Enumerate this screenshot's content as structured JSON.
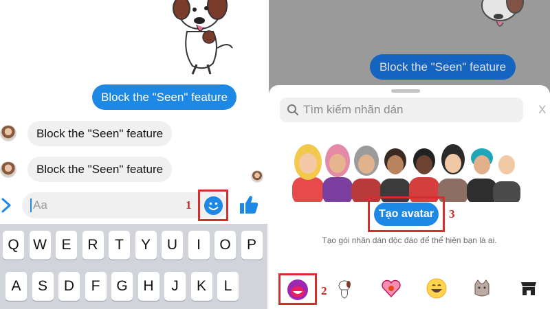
{
  "left_panel": {
    "messages": [
      {
        "direction": "outgoing",
        "text": "Block the \"Seen\" feature"
      },
      {
        "direction": "incoming",
        "text": "Block the \"Seen\" feature"
      },
      {
        "direction": "incoming",
        "text": "Block the \"Seen\" feature"
      }
    ],
    "compose": {
      "placeholder": "Aa",
      "emoji_button_icon": "smile-icon",
      "like_button_icon": "thumbs-up-icon",
      "expand_icon": "chevron-right-icon"
    },
    "keyboard": {
      "row1": [
        "Q",
        "W",
        "E",
        "R",
        "T",
        "Y",
        "U",
        "I",
        "O",
        "P"
      ],
      "row2": [
        "A",
        "S",
        "D",
        "F",
        "G",
        "H",
        "J",
        "K",
        "L"
      ]
    }
  },
  "right_panel": {
    "background_message": "Block the \"Seen\" feature",
    "sheet": {
      "search_placeholder": "Tìm kiếm nhãn dán",
      "close_label": "X",
      "cta_label": "Tạo avatar",
      "description": "Tạo gói nhãn dán độc đáo để thể hiện bạn là ai.",
      "tabs": [
        {
          "icon": "avatar-create-icon",
          "selected": true
        },
        {
          "icon": "dog-sticker-icon",
          "selected": false
        },
        {
          "icon": "heart-sticker-icon",
          "selected": false
        },
        {
          "icon": "smiley-sticker-icon",
          "selected": false
        },
        {
          "icon": "cat-sticker-icon",
          "selected": false
        },
        {
          "icon": "store-icon",
          "selected": false
        }
      ]
    }
  },
  "step_markers": {
    "emoji_step": "1",
    "avatar_tab_step": "2",
    "create_avatar_step": "3"
  },
  "colors": {
    "messenger_blue": "#1e88e5",
    "highlight_red": "#d32f2f",
    "incoming_bubble": "#f0f0f0",
    "keyboard_bg": "#d1d4da"
  }
}
